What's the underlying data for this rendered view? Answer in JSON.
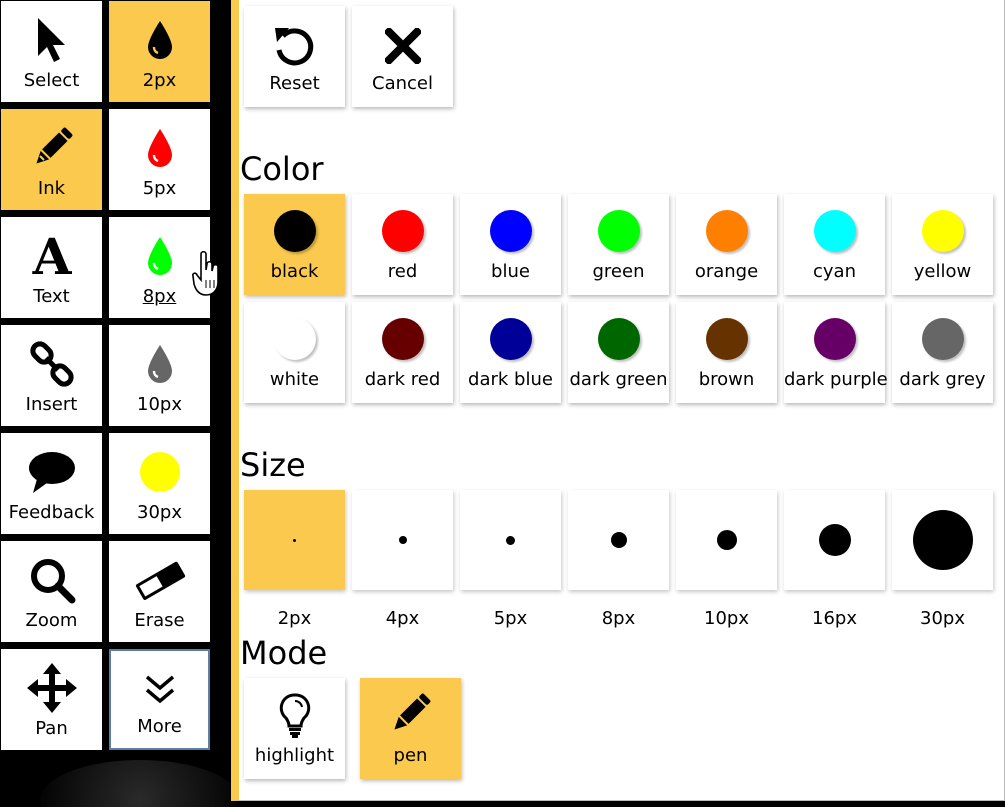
{
  "toolbar": {
    "tools": [
      {
        "id": "select",
        "label": "Select",
        "icon": "arrow-cursor-icon",
        "active": false
      },
      {
        "id": "ink",
        "label": "Ink",
        "icon": "pencil-icon",
        "active": true
      },
      {
        "id": "text",
        "label": "Text",
        "icon": "text-a-icon",
        "active": false
      },
      {
        "id": "insert",
        "label": "Insert",
        "icon": "link-chain-icon",
        "active": false
      },
      {
        "id": "feedback",
        "label": "Feedback",
        "icon": "speech-bubble-icon",
        "active": false
      },
      {
        "id": "zoom",
        "label": "Zoom",
        "icon": "magnifier-icon",
        "active": false
      },
      {
        "id": "pan",
        "label": "Pan",
        "icon": "move-arrows-icon",
        "active": false
      }
    ],
    "quick_sizes": [
      {
        "label": "2px",
        "icon": "drop-icon",
        "color": "#000000",
        "active": true
      },
      {
        "label": "5px",
        "icon": "drop-icon",
        "color": "#ff0000",
        "active": false
      },
      {
        "label": "8px",
        "icon": "drop-icon",
        "color": "#00ff00",
        "active": false
      },
      {
        "label": "10px",
        "icon": "drop-icon",
        "color": "#666666",
        "active": false
      },
      {
        "label": "30px",
        "icon": "circle-icon",
        "color": "#ffff00",
        "active": false
      },
      {
        "label": "Erase",
        "icon": "eraser-icon",
        "color": "#000000",
        "active": false
      },
      {
        "label": "More",
        "icon": "double-chevron-down-icon",
        "color": "#000000",
        "active": false
      }
    ]
  },
  "panel": {
    "actions": [
      {
        "label": "Reset",
        "icon": "undo-arrow-icon"
      },
      {
        "label": "Cancel",
        "icon": "x-close-icon"
      }
    ],
    "color_title": "Color",
    "colors": [
      {
        "label": "black",
        "hex": "#000000",
        "active": true
      },
      {
        "label": "red",
        "hex": "#ff0000",
        "active": false
      },
      {
        "label": "blue",
        "hex": "#0000ff",
        "active": false
      },
      {
        "label": "green",
        "hex": "#00ff00",
        "active": false
      },
      {
        "label": "orange",
        "hex": "#ff8000",
        "active": false
      },
      {
        "label": "cyan",
        "hex": "#00ffff",
        "active": false
      },
      {
        "label": "yellow",
        "hex": "#ffff00",
        "active": false
      },
      {
        "label": "white",
        "hex": "#ffffff",
        "active": false
      },
      {
        "label": "dark red",
        "hex": "#660000",
        "active": false
      },
      {
        "label": "dark blue",
        "hex": "#000099",
        "active": false
      },
      {
        "label": "dark green",
        "hex": "#006600",
        "active": false
      },
      {
        "label": "brown",
        "hex": "#663300",
        "active": false
      },
      {
        "label": "dark purple",
        "hex": "#660066",
        "active": false
      },
      {
        "label": "dark grey",
        "hex": "#666666",
        "active": false
      }
    ],
    "size_title": "Size",
    "sizes": [
      {
        "label": "2px",
        "active": true
      },
      {
        "label": "4px",
        "active": false
      },
      {
        "label": "5px",
        "active": false
      },
      {
        "label": "8px",
        "active": false
      },
      {
        "label": "10px",
        "active": false
      },
      {
        "label": "16px",
        "active": false
      },
      {
        "label": "30px",
        "active": false
      }
    ],
    "mode_title": "Mode",
    "modes": [
      {
        "label": "highlight",
        "icon": "lightbulb-icon",
        "active": false
      },
      {
        "label": "pen",
        "icon": "pencil-icon",
        "active": true
      }
    ]
  },
  "colors": {
    "accent": "#fbc94e",
    "focus_outline": "#5c7fa7"
  }
}
